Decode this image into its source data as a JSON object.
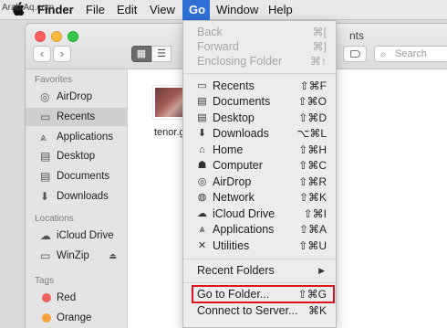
{
  "watermark": "Arab Aq.com",
  "menubar": {
    "items": [
      "Finder",
      "File",
      "Edit",
      "View",
      "Go",
      "Window",
      "Help"
    ]
  },
  "window": {
    "title_fragment": "nts",
    "search_placeholder": "Search"
  },
  "sidebar": {
    "favorites_heading": "Favorites",
    "favorites": [
      {
        "label": "AirDrop",
        "icon": "airdrop-icon"
      },
      {
        "label": "Recents",
        "icon": "recents-icon",
        "selected": true
      },
      {
        "label": "Applications",
        "icon": "applications-icon"
      },
      {
        "label": "Desktop",
        "icon": "desktop-icon"
      },
      {
        "label": "Documents",
        "icon": "documents-icon"
      },
      {
        "label": "Downloads",
        "icon": "downloads-icon"
      }
    ],
    "locations_heading": "Locations",
    "locations": [
      {
        "label": "iCloud Drive",
        "icon": "cloud-icon"
      },
      {
        "label": "WinZip",
        "icon": "drive-icon",
        "eject": true
      }
    ],
    "tags_heading": "Tags",
    "tags": [
      {
        "label": "Red",
        "color": "#f0605c"
      },
      {
        "label": "Orange",
        "color": "#f7a33b"
      }
    ]
  },
  "content": {
    "file_label": "tenor.g"
  },
  "gomenu": {
    "nav": [
      {
        "label": "Back",
        "shortcut": "⌘[",
        "disabled": true
      },
      {
        "label": "Forward",
        "shortcut": "⌘]",
        "disabled": true
      },
      {
        "label": "Enclosing Folder",
        "shortcut": "⌘↑",
        "disabled": true
      }
    ],
    "places": [
      {
        "label": "Recents",
        "shortcut": "⇧⌘F",
        "icon": "recents-icon"
      },
      {
        "label": "Documents",
        "shortcut": "⇧⌘O",
        "icon": "documents-icon"
      },
      {
        "label": "Desktop",
        "shortcut": "⇧⌘D",
        "icon": "desktop-icon"
      },
      {
        "label": "Downloads",
        "shortcut": "⌥⌘L",
        "icon": "downloads-icon"
      },
      {
        "label": "Home",
        "shortcut": "⇧⌘H",
        "icon": "home-icon"
      },
      {
        "label": "Computer",
        "shortcut": "⇧⌘C",
        "icon": "computer-icon"
      },
      {
        "label": "AirDrop",
        "shortcut": "⇧⌘R",
        "icon": "airdrop-icon"
      },
      {
        "label": "Network",
        "shortcut": "⇧⌘K",
        "icon": "network-icon"
      },
      {
        "label": "iCloud Drive",
        "shortcut": "⇧⌘I",
        "icon": "cloud-icon"
      },
      {
        "label": "Applications",
        "shortcut": "⇧⌘A",
        "icon": "applications-icon"
      },
      {
        "label": "Utilities",
        "shortcut": "⇧⌘U",
        "icon": "utilities-icon"
      }
    ],
    "recent_folders": "Recent Folders",
    "goto_folder": {
      "label": "Go to Folder...",
      "shortcut": "⇧⌘G"
    },
    "connect_server": {
      "label": "Connect to Server...",
      "shortcut": "⌘K"
    }
  },
  "colors": {
    "menubar_active": "#2f6fd6",
    "highlight_box": "#e0141c"
  }
}
